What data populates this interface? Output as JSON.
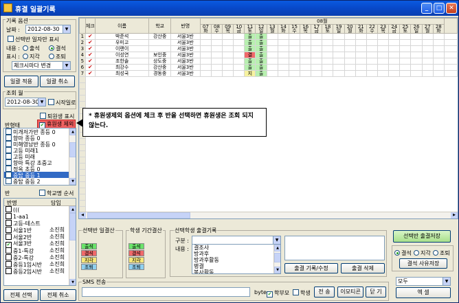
{
  "window": {
    "title": "휴결 일괄기록"
  },
  "left": {
    "options_title": "기록 옵션",
    "date_label": "날짜 :",
    "date_value": "2012-08-30",
    "only_selected_label": "선택반 일자만 표시",
    "content_label": "내용 :",
    "content_radios": [
      "출석",
      "결석"
    ],
    "display_label": "표시 :",
    "display_radios": [
      "지각",
      "조퇴"
    ],
    "change_combo": "체크시마다 변경",
    "bulk_apply": "일괄 적용",
    "bulk_cancel": "일괄 취소",
    "view_month_title": "조회 월",
    "view_month_value": "2012-08-30",
    "start_day_label": "시작일로",
    "withdrawn_label": "퇴원생 표시",
    "exclude_leave_label": "휴원생 제외",
    "class_type_label": "반형태",
    "class_types": [
      "미개저가반 종등 0",
      "향마 종등 0",
      "미해영남반 종등 0",
      "고등 미래1",
      "고등 미래",
      "향마 특강 초중고",
      "정옥 초등 0",
      "중탑 중등 1",
      "중탑 중등 2"
    ],
    "class_types_selected": 7,
    "class_label": "반",
    "school_name_order_label": "학교명 순서",
    "class_cols": [
      "반명",
      "담임"
    ],
    "classes": [
      {
        "name": "(((",
        "teacher": ""
      },
      {
        "name": "1-aa1",
        "teacher": ""
      },
      {
        "name": "고등-테스트",
        "teacher": ""
      },
      {
        "name": "서울1반",
        "teacher": "소진희"
      },
      {
        "name": "서울2반",
        "teacher": "소진희"
      },
      {
        "name": "서울3반",
        "teacher": "소진희"
      },
      {
        "name": "중1-특강",
        "teacher": "소진희"
      },
      {
        "name": "중2-특강",
        "teacher": "소진희"
      },
      {
        "name": "중등1임시반",
        "teacher": "소진희"
      },
      {
        "name": "중등2임시반",
        "teacher": "소진희"
      }
    ],
    "select_all": "전체 선택",
    "deselect_all": "전체 취소"
  },
  "grid": {
    "month_label": "08월",
    "headers": [
      "체크",
      "이름",
      "학교",
      "반명"
    ],
    "days": [
      "07",
      "08",
      "09",
      "10",
      "11",
      "12",
      "13",
      "14",
      "15",
      "16",
      "17",
      "18",
      "19",
      "20",
      "21",
      "22",
      "23",
      "24",
      "25",
      "26",
      "27",
      "28"
    ],
    "weekdays": [
      "화",
      "수",
      "목",
      "금",
      "토",
      "일",
      "월",
      "화",
      "수",
      "목",
      "금",
      "토",
      "일",
      "월",
      "화",
      "수",
      "목",
      "금",
      "토",
      "일",
      "월",
      "화"
    ],
    "rows": [
      {
        "no": "1",
        "name": "박준석",
        "school": "강산중",
        "class": "서울3반",
        "d11": "출",
        "d12": "출"
      },
      {
        "no": "2",
        "name": "우미고",
        "school": "",
        "class": "서울3반",
        "d11": "출",
        "d12": "출"
      },
      {
        "no": "3",
        "name": "이랜이",
        "school": "",
        "class": "서울3반",
        "d11": "출",
        "d12": "출"
      },
      {
        "no": "4",
        "name": "이성연",
        "school": "보인중",
        "class": "서울3반",
        "d11": "결",
        "d12": "출"
      },
      {
        "no": "5",
        "name": "조한솔",
        "school": "상도중",
        "class": "서울3반",
        "d11": "출",
        "d12": "출"
      },
      {
        "no": "6",
        "name": "최강수",
        "school": "강산중",
        "class": "서울3반",
        "d11": "출",
        "d12": "출"
      },
      {
        "no": "7",
        "name": "최성국",
        "school": "경동중",
        "class": "서울3반",
        "d11": "지",
        "d12": "출"
      }
    ]
  },
  "tooltip": {
    "text": "* 휴원생제외 옵션에 체크 후 반을 선택하면 휴원생은 조회 되지 않는다."
  },
  "bottom": {
    "class_summary_title": "선택반 일결산",
    "student_summary_title": "학생 기간결산",
    "tags": [
      "출석",
      "결석",
      "지각",
      "조퇴"
    ],
    "record_title": "선택학생 출결기록",
    "type_label": "구분 :",
    "content_label": "내용 :",
    "content_items": [
      "결조사",
      "방과후",
      "방과후활동",
      "병결",
      "봉사활동"
    ],
    "record_edit": "출결 기록/수정",
    "record_delete": "출결 삭제",
    "save_class_attendance": "선택반 출결저장",
    "right_radios": [
      "결석",
      "지각",
      "조퇴"
    ],
    "save_absence_reason": "결석 사유저장",
    "scope_combo": "모두",
    "excel": "엑    셀",
    "sms_title": "SMS 전송",
    "byte_label": "byte",
    "parent_label": "학부모",
    "student_label": "학생",
    "send": "전 송",
    "emoticon": "이모티콘",
    "close": "닫 기"
  }
}
